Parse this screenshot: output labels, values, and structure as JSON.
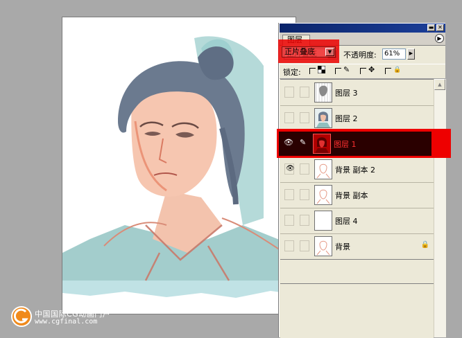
{
  "panel": {
    "tab_label": "图层",
    "titlebar_buttons": {
      "minimize": "▬",
      "close": "✕"
    },
    "menu_glyph": "▶"
  },
  "options": {
    "blend_mode": "正片叠底",
    "blend_arrow": "▼",
    "opacity_label": "不透明度:",
    "opacity_value": "61%",
    "opacity_arrow": "▶"
  },
  "lock": {
    "label": "锁定:",
    "items": [
      {
        "name": "lock-transparency",
        "icon": "checker-icon"
      },
      {
        "name": "lock-image",
        "icon": "brush-icon",
        "glyph": "✎"
      },
      {
        "name": "lock-position",
        "icon": "move-icon",
        "glyph": "✥"
      },
      {
        "name": "lock-all",
        "icon": "lock-icon",
        "glyph": "🔒"
      }
    ]
  },
  "layers": [
    {
      "name": "图层 3",
      "visible": false,
      "selected": false,
      "thumb": "sketch"
    },
    {
      "name": "图层 2",
      "visible": false,
      "selected": false,
      "thumb": "color-face"
    },
    {
      "name": "图层 1",
      "visible": true,
      "selected": true,
      "thumb": "red-face"
    },
    {
      "name": "背景 副本 2",
      "visible": true,
      "selected": false,
      "thumb": "line-face"
    },
    {
      "name": "背景 副本",
      "visible": false,
      "selected": false,
      "thumb": "line-face"
    },
    {
      "name": "图层 4",
      "visible": false,
      "selected": false,
      "thumb": "blank"
    },
    {
      "name": "背景",
      "visible": false,
      "selected": false,
      "thumb": "line-face",
      "locked": true
    }
  ],
  "glyphs": {
    "eye": "👁",
    "brush": "✎",
    "lock": "🔒",
    "scroll_up": "▲"
  },
  "watermark": {
    "line1": "中国国际CG动画门户",
    "line2": "www.cgfinal.com"
  },
  "colors": {
    "highlight": "#ee0000",
    "selected_row": "#2a0000",
    "titlebar": "#0a246a",
    "panel_bg": "#ece9d8"
  }
}
